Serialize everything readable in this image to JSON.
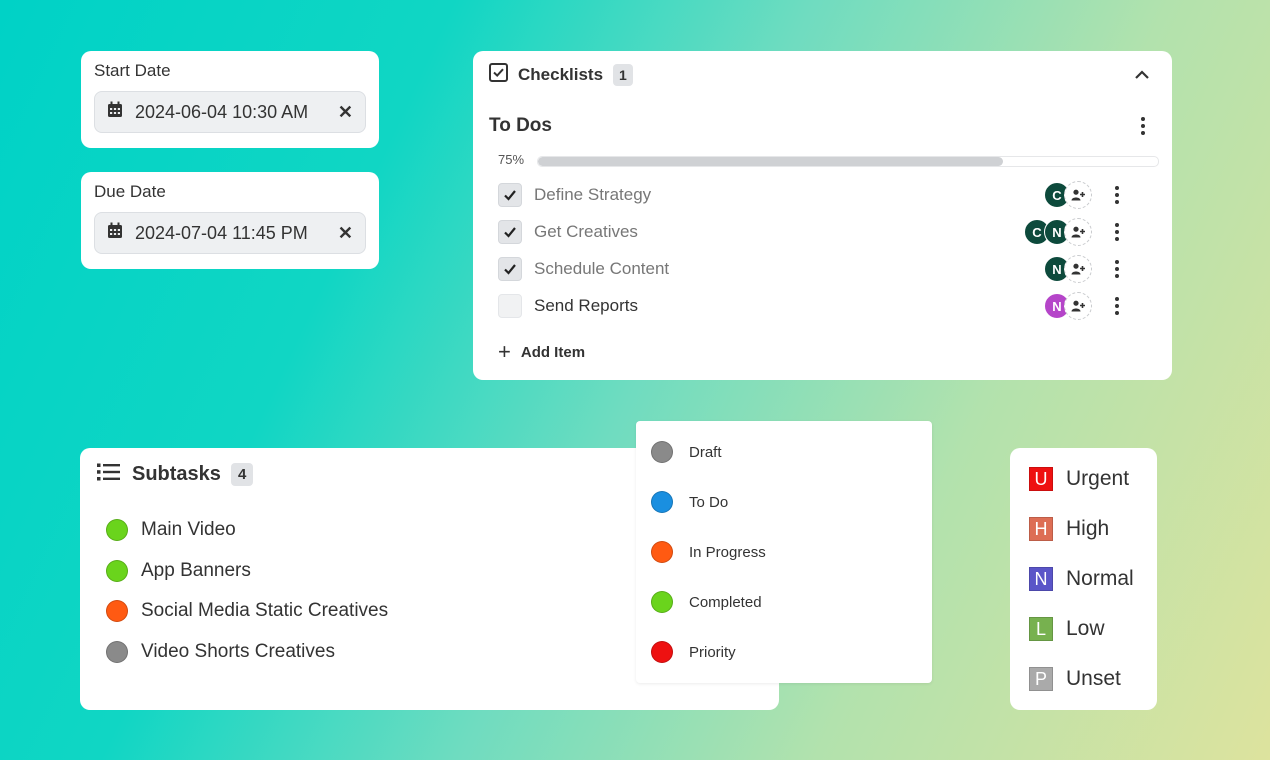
{
  "start_date": {
    "label": "Start Date",
    "value": "2024-06-04 10:30 AM"
  },
  "due_date": {
    "label": "Due Date",
    "value": "2024-07-04 11:45 PM"
  },
  "checklist": {
    "title": "Checklists",
    "count": "1",
    "list_title": "To Dos",
    "progress_label": "75%",
    "progress": 0.75,
    "items": [
      {
        "label": "Define Strategy",
        "checked": true,
        "assignees": [
          {
            "initial": "C",
            "color": "#0d4a3c"
          }
        ]
      },
      {
        "label": "Get Creatives",
        "checked": true,
        "assignees": [
          {
            "initial": "C",
            "color": "#0d4a3c"
          },
          {
            "initial": "N",
            "color": "#0d4a3c"
          }
        ]
      },
      {
        "label": "Schedule Content",
        "checked": true,
        "assignees": [
          {
            "initial": "N",
            "color": "#0d4a3c"
          }
        ]
      },
      {
        "label": "Send Reports",
        "checked": false,
        "assignees": [
          {
            "initial": "N",
            "color": "#b545c9"
          }
        ]
      }
    ],
    "add_item_label": "Add Item"
  },
  "subtasks": {
    "title": "Subtasks",
    "count": "4",
    "items": [
      {
        "label": "Main Video",
        "color": "#6ad41c"
      },
      {
        "label": "App Banners",
        "color": "#6ad41c"
      },
      {
        "label": "Social Media Static Creatives",
        "color": "#ff5a12"
      },
      {
        "label": "Video Shorts Creatives",
        "color": "#8a8a8a"
      }
    ]
  },
  "status_options": [
    {
      "label": "Draft",
      "color": "#8a8a8a"
    },
    {
      "label": "To Do",
      "color": "#1a8fe0"
    },
    {
      "label": "In Progress",
      "color": "#ff5a12"
    },
    {
      "label": "Completed",
      "color": "#6ad41c"
    },
    {
      "label": "Priority",
      "color": "#ee1111"
    }
  ],
  "priorities": [
    {
      "letter": "U",
      "label": "Urgent",
      "color": "#ee1111"
    },
    {
      "letter": "H",
      "label": "High",
      "color": "#dd6e55"
    },
    {
      "letter": "N",
      "label": "Normal",
      "color": "#5a55c8"
    },
    {
      "letter": "L",
      "label": "Low",
      "color": "#77b14f"
    },
    {
      "letter": "P",
      "label": "Unset",
      "color": "#aaaaaa"
    }
  ]
}
